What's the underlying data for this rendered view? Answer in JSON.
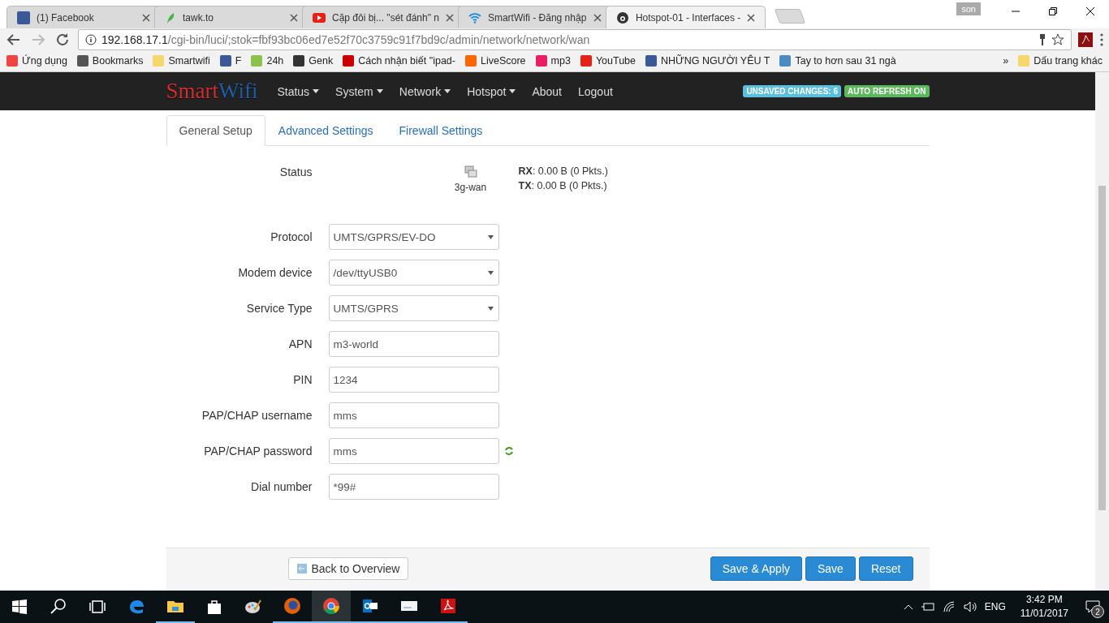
{
  "browser": {
    "tabs": [
      {
        "title": "(1) Facebook",
        "selected": false
      },
      {
        "title": "tawk.to",
        "selected": false
      },
      {
        "title": "Cặp đôi bị... \"sét đánh\" n",
        "selected": false
      },
      {
        "title": "SmartWifi - Đăng nhập",
        "selected": false
      },
      {
        "title": "Hotspot-01 - Interfaces -",
        "selected": true
      }
    ],
    "profile": "son",
    "address": {
      "host": "192.168.17.1",
      "path": "/cgi-bin/luci/;stok=fbf93bc06ed7e52f70c3759c91f7bd9c/admin/network/network/wan"
    },
    "bookmarks": [
      "Ứng dụng",
      "Bookmarks",
      "Smartwifi",
      "F",
      "24h",
      "Genk",
      "Cách nhận biết \"ipad-",
      "LiveScore",
      "mp3",
      "YouTube",
      "NHỮNG NGƯỜI YÊU T",
      "Tay to hơn sau 31 ngà"
    ],
    "more": "»",
    "other_bookmarks": "Dấu trang khác"
  },
  "page": {
    "brand": {
      "first": "Smart",
      "second": "Wifi"
    },
    "menu": [
      {
        "label": "Status",
        "dropdown": true
      },
      {
        "label": "System",
        "dropdown": true
      },
      {
        "label": "Network",
        "dropdown": true
      },
      {
        "label": "Hotspot",
        "dropdown": true
      },
      {
        "label": "About",
        "dropdown": false
      },
      {
        "label": "Logout",
        "dropdown": false
      }
    ],
    "badges": [
      {
        "label": "UNSAVED CHANGES: 6",
        "color": "#5bc0de"
      },
      {
        "label": "AUTO REFRESH ON",
        "color": "#5cb85c"
      }
    ],
    "tabs": [
      {
        "label": "General Setup",
        "selected": true
      },
      {
        "label": "Advanced Settings",
        "selected": false
      },
      {
        "label": "Firewall Settings",
        "selected": false
      }
    ],
    "status": {
      "label": "Status",
      "device": "3g-wan",
      "rx_label": "RX",
      "rx": ": 0.00 B (0 Pkts.)",
      "tx_label": "TX",
      "tx": ": 0.00 B (0 Pkts.)"
    },
    "fields": [
      {
        "label": "Protocol",
        "kind": "select",
        "value": "UMTS/GPRS/EV-DO"
      },
      {
        "label": "Modem device",
        "kind": "select",
        "value": "/dev/ttyUSB0"
      },
      {
        "label": "Service Type",
        "kind": "select",
        "value": "UMTS/GPRS"
      },
      {
        "label": "APN",
        "kind": "text",
        "value": "m3-world"
      },
      {
        "label": "PIN",
        "kind": "text",
        "value": "1234"
      },
      {
        "label": "PAP/CHAP username",
        "kind": "text",
        "value": "mms"
      },
      {
        "label": "PAP/CHAP password",
        "kind": "password",
        "value": "mms"
      },
      {
        "label": "Dial number",
        "kind": "text",
        "value": "*99#"
      }
    ],
    "back_button": "Back to Overview",
    "buttons": [
      "Save & Apply",
      "Save",
      "Reset"
    ]
  },
  "taskbar": {
    "language": "ENG",
    "time": "3:42 PM",
    "date": "11/01/2017",
    "notifications": "2"
  }
}
